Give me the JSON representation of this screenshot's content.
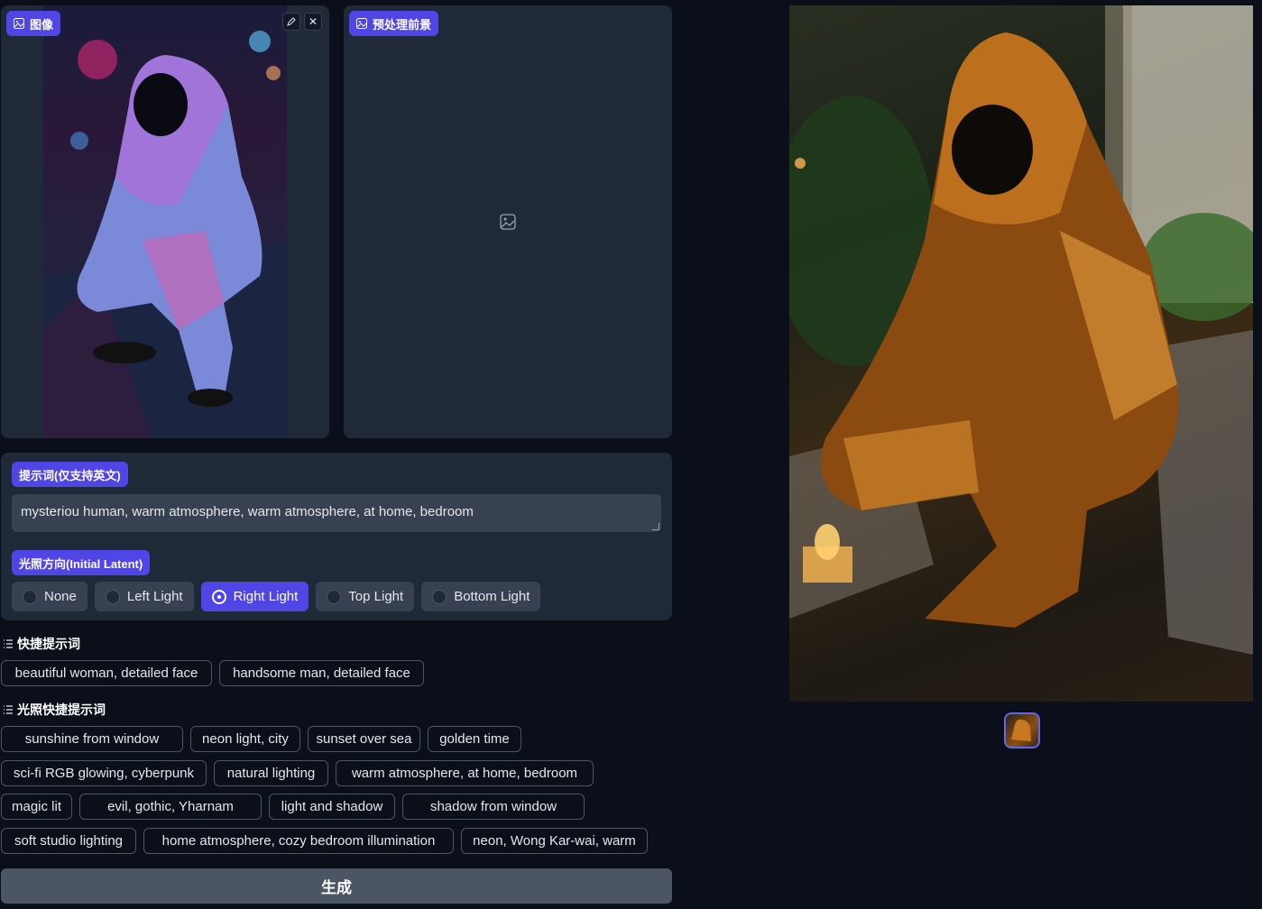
{
  "image_panel": {
    "label": "图像",
    "edit_icon": "pencil-icon",
    "close_icon": "close-icon"
  },
  "preprocess_panel": {
    "label": "预处理前景",
    "placeholder_icon": "image-icon"
  },
  "prompt": {
    "label": "提示词(仅支持英文)",
    "value": "mysteriou human, warm atmosphere, warm atmosphere, at home, bedroom"
  },
  "lighting": {
    "label": "光照方向(Initial Latent)",
    "options": [
      "None",
      "Left Light",
      "Right Light",
      "Top Light",
      "Bottom Light"
    ],
    "selected": "Right Light"
  },
  "quick_prompts": {
    "title": "快捷提示词",
    "items": [
      "beautiful woman, detailed face",
      "handsome man, detailed face"
    ]
  },
  "light_quick_prompts": {
    "title": "光照快捷提示词",
    "rows": [
      [
        "sunshine from window",
        "neon light, city",
        "sunset over sea",
        "golden time"
      ],
      [
        "sci-fi RGB glowing, cyberpunk",
        "natural lighting",
        "warm atmosphere, at home, bedroom"
      ],
      [
        "magic lit",
        "evil, gothic, Yharnam",
        "light and shadow",
        "shadow from window"
      ],
      [
        "soft studio lighting",
        "home atmosphere, cozy bedroom illumination",
        "neon, Wong Kar-wai, warm"
      ]
    ]
  },
  "generate_label": "生成",
  "colors": {
    "accent": "#4f46e5",
    "background": "#0b0f19",
    "panel": "#1f2937"
  }
}
